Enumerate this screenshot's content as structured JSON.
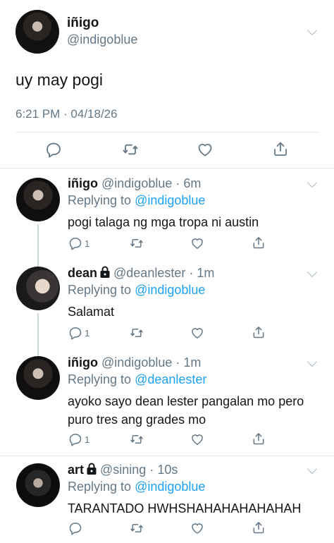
{
  "main_tweet": {
    "name": "iñigo",
    "handle": "@indigoblue",
    "text": "uy may pogi",
    "timestamp": "6:21 PM · 04/18/26"
  },
  "replies": [
    {
      "name": "iñigo",
      "handle_time": "@indigoblue · 6m",
      "replying_prefix": "Replying to",
      "replying_to": "@indigoblue",
      "text": "pogi talaga ng mga tropa ni austin",
      "reply_count": "1",
      "locked": false
    },
    {
      "name": "dean",
      "handle_time": "@deanlester · 1m",
      "replying_prefix": "Replying to",
      "replying_to": "@indigoblue",
      "text": "Salamat",
      "reply_count": "1",
      "locked": true
    },
    {
      "name": "iñigo",
      "handle_time": "@indigoblue · 1m",
      "replying_prefix": "Replying to",
      "replying_to": "@deanlester",
      "text": "ayoko sayo dean lester pangalan mo pero puro tres ang grades mo",
      "reply_count": "1",
      "locked": false
    },
    {
      "name": "art",
      "handle_time": "@sining · 10s",
      "replying_prefix": "Replying to",
      "replying_to": "@indigoblue",
      "text": "TARANTADO HWHSHAHAHAHAHAHAH",
      "reply_count": "",
      "locked": true
    }
  ],
  "colors": {
    "link": "#1da1f2",
    "muted": "#657786",
    "text": "#14171a"
  }
}
